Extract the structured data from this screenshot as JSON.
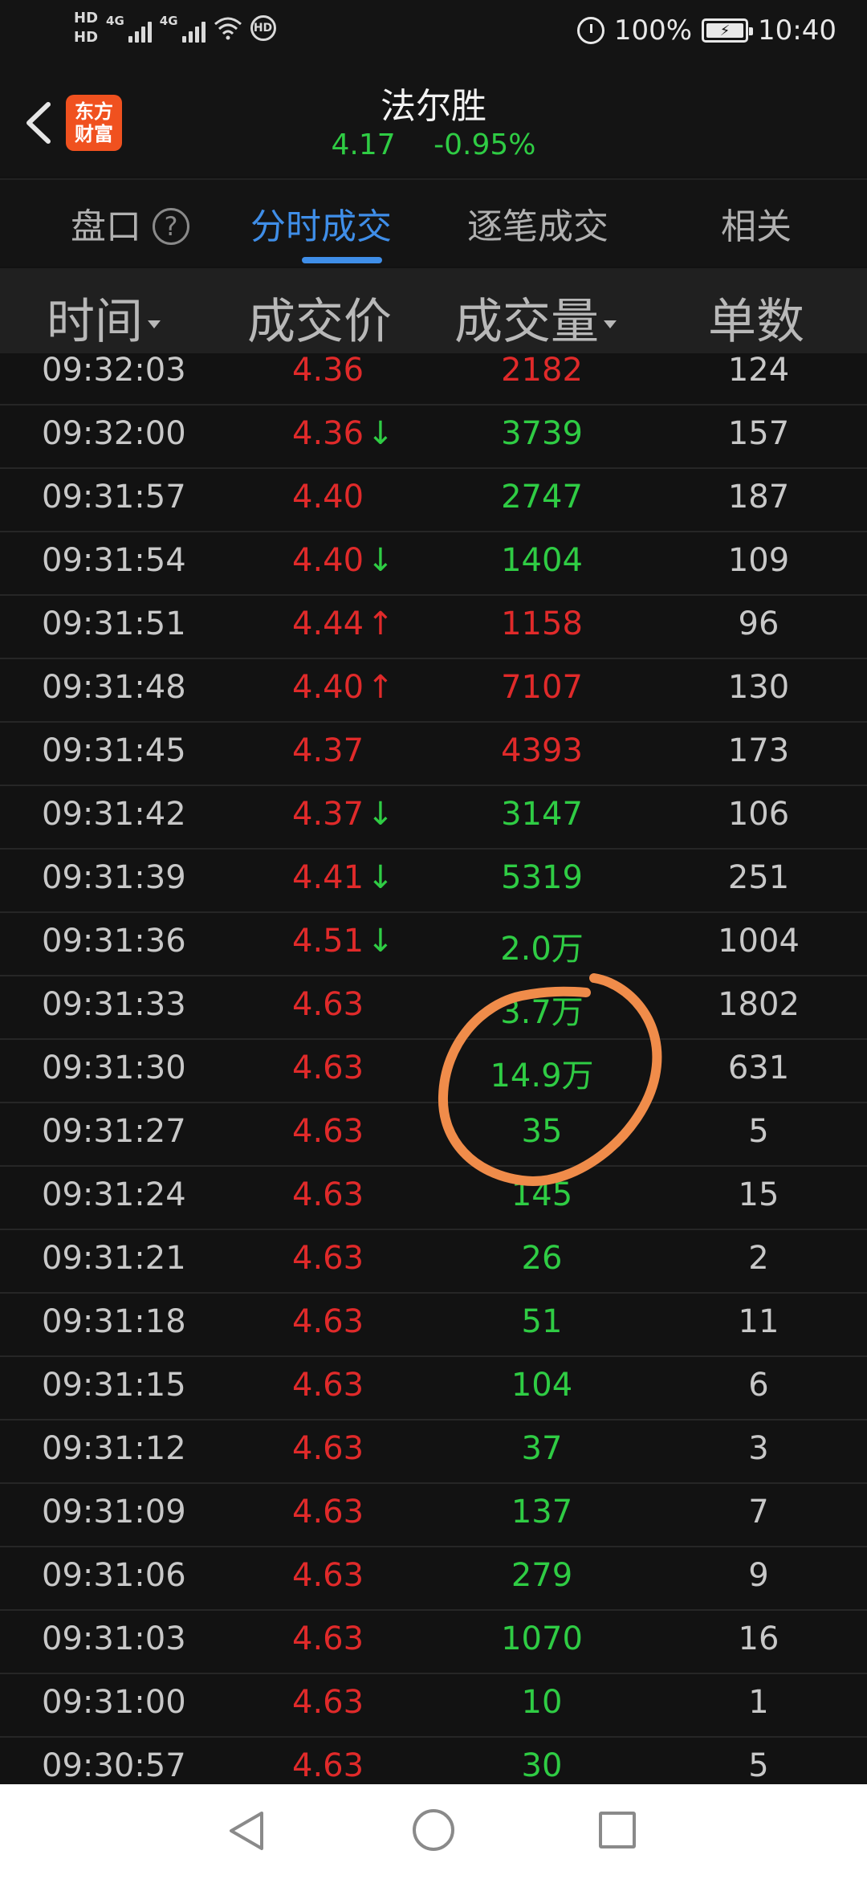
{
  "status_bar": {
    "hd1": "HD",
    "hd2": "HD",
    "sig1_label": "4G",
    "sig2_label": "4G",
    "hd_badge": "HD",
    "battery_text": "100%",
    "time": "10:40"
  },
  "header": {
    "logo_line1": "东方",
    "logo_line2": "财富",
    "stock_name": "法尔胜",
    "price": "4.17",
    "change": "-0.95%"
  },
  "tabs": [
    {
      "label": "盘口",
      "active": false
    },
    {
      "label": "分时成交",
      "active": true
    },
    {
      "label": "逐笔成交",
      "active": false
    },
    {
      "label": "相关",
      "active": false
    }
  ],
  "help_icon": "?",
  "columns": {
    "time": "时间",
    "price": "成交价",
    "volume": "成交量",
    "count": "单数"
  },
  "colors": {
    "up": "#e02a2a",
    "down": "#2fcc44",
    "accent": "#3f8ee8",
    "logo": "#f0511f",
    "annotation": "#f08c4a"
  },
  "rows": [
    {
      "time": "09:32:03",
      "price": "4.36",
      "arrow": "",
      "volume": "2182",
      "vol_color": "red",
      "count": "124"
    },
    {
      "time": "09:32:00",
      "price": "4.36",
      "arrow": "↓",
      "volume": "3739",
      "vol_color": "green",
      "count": "157"
    },
    {
      "time": "09:31:57",
      "price": "4.40",
      "arrow": "",
      "volume": "2747",
      "vol_color": "green",
      "count": "187"
    },
    {
      "time": "09:31:54",
      "price": "4.40",
      "arrow": "↓",
      "volume": "1404",
      "vol_color": "green",
      "count": "109"
    },
    {
      "time": "09:31:51",
      "price": "4.44",
      "arrow": "↑",
      "volume": "1158",
      "vol_color": "red",
      "count": "96"
    },
    {
      "time": "09:31:48",
      "price": "4.40",
      "arrow": "↑",
      "volume": "7107",
      "vol_color": "red",
      "count": "130"
    },
    {
      "time": "09:31:45",
      "price": "4.37",
      "arrow": "",
      "volume": "4393",
      "vol_color": "red",
      "count": "173"
    },
    {
      "time": "09:31:42",
      "price": "4.37",
      "arrow": "↓",
      "volume": "3147",
      "vol_color": "green",
      "count": "106"
    },
    {
      "time": "09:31:39",
      "price": "4.41",
      "arrow": "↓",
      "volume": "5319",
      "vol_color": "green",
      "count": "251"
    },
    {
      "time": "09:31:36",
      "price": "4.51",
      "arrow": "↓",
      "volume": "2.0万",
      "vol_color": "green",
      "count": "1004"
    },
    {
      "time": "09:31:33",
      "price": "4.63",
      "arrow": "",
      "volume": "3.7万",
      "vol_color": "green",
      "count": "1802"
    },
    {
      "time": "09:31:30",
      "price": "4.63",
      "arrow": "",
      "volume": "14.9万",
      "vol_color": "green",
      "count": "631"
    },
    {
      "time": "09:31:27",
      "price": "4.63",
      "arrow": "",
      "volume": "35",
      "vol_color": "green",
      "count": "5"
    },
    {
      "time": "09:31:24",
      "price": "4.63",
      "arrow": "",
      "volume": "145",
      "vol_color": "green",
      "count": "15"
    },
    {
      "time": "09:31:21",
      "price": "4.63",
      "arrow": "",
      "volume": "26",
      "vol_color": "green",
      "count": "2"
    },
    {
      "time": "09:31:18",
      "price": "4.63",
      "arrow": "",
      "volume": "51",
      "vol_color": "green",
      "count": "11"
    },
    {
      "time": "09:31:15",
      "price": "4.63",
      "arrow": "",
      "volume": "104",
      "vol_color": "green",
      "count": "6"
    },
    {
      "time": "09:31:12",
      "price": "4.63",
      "arrow": "",
      "volume": "37",
      "vol_color": "green",
      "count": "3"
    },
    {
      "time": "09:31:09",
      "price": "4.63",
      "arrow": "",
      "volume": "137",
      "vol_color": "green",
      "count": "7"
    },
    {
      "time": "09:31:06",
      "price": "4.63",
      "arrow": "",
      "volume": "279",
      "vol_color": "green",
      "count": "9"
    },
    {
      "time": "09:31:03",
      "price": "4.63",
      "arrow": "",
      "volume": "1070",
      "vol_color": "green",
      "count": "16"
    },
    {
      "time": "09:31:00",
      "price": "4.63",
      "arrow": "",
      "volume": "10",
      "vol_color": "green",
      "count": "1"
    },
    {
      "time": "09:30:57",
      "price": "4.63",
      "arrow": "",
      "volume": "30",
      "vol_color": "green",
      "count": "5"
    }
  ]
}
